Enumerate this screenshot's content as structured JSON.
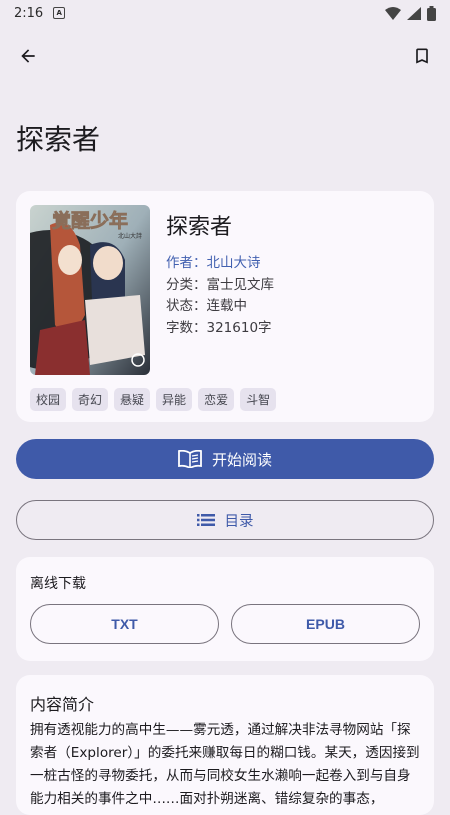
{
  "status_bar": {
    "time": "2:16",
    "sim_glyph": "A"
  },
  "page": {
    "title": "探索者"
  },
  "book": {
    "title": "探索者",
    "author": "作者：北山大诗",
    "category": "分类：富士见文库",
    "status": "状态：连载中",
    "word_count": "字数：321610字",
    "cover_text": "覚醒少年",
    "cover_sub": "北山大詩",
    "tags": [
      "校园",
      "奇幻",
      "悬疑",
      "异能",
      "恋爱",
      "斗智"
    ]
  },
  "actions": {
    "start_reading": "开始阅读",
    "toc": "目录"
  },
  "download": {
    "section_title": "离线下载",
    "txt_label": "TXT",
    "epub_label": "EPUB"
  },
  "intro": {
    "title": "内容简介",
    "text": "拥有透视能力的高中生——雾元透，通过解决非法寻物网站「探索者（Explorer）」的委托来赚取每日的糊口钱。某天，透因接到一桩古怪的寻物委托，从而与同校女生水濑响一起卷入到与自身能力相关的事件之中……面对扑朔迷离、错综复杂的事态，"
  },
  "colors": {
    "accent": "#3f5aa9",
    "background": "#efebf2",
    "card": "#fbf8fd",
    "tag_bg": "#e6e2ee"
  }
}
